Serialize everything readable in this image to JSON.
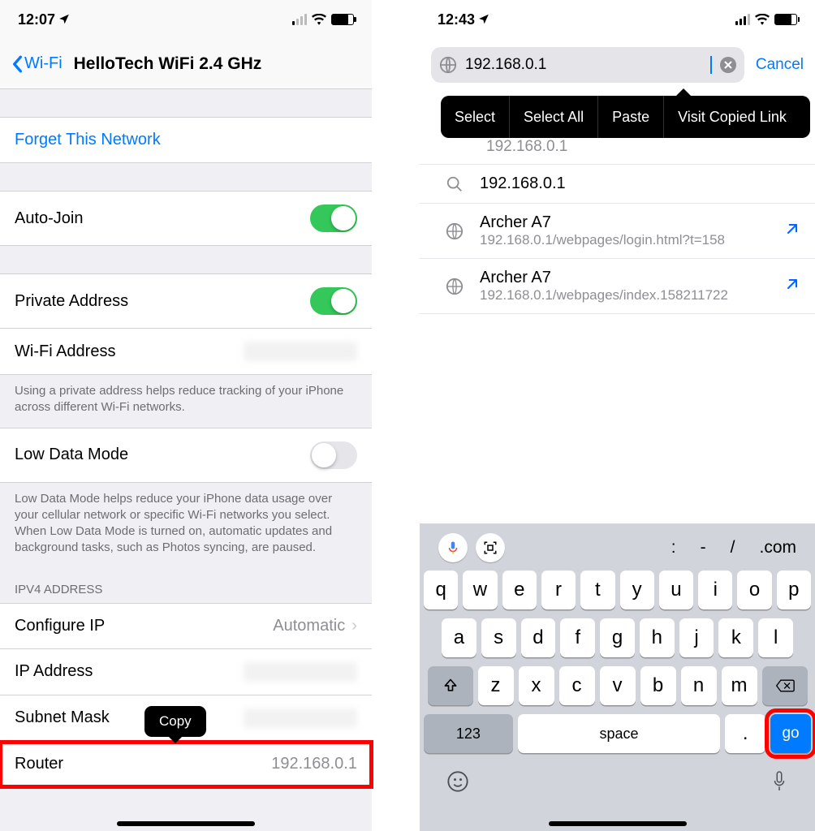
{
  "left": {
    "status_time": "12:07",
    "back_label": "Wi-Fi",
    "page_title": "HelloTech WiFi 2.4 GHz",
    "forget": "Forget This Network",
    "auto_join": "Auto-Join",
    "private_addr": "Private Address",
    "wifi_addr": "Wi-Fi Address",
    "private_footer": "Using a private address helps reduce tracking of your iPhone across different Wi-Fi networks.",
    "low_data": "Low Data Mode",
    "low_data_footer": "Low Data Mode helps reduce your iPhone data usage over your cellular network or specific Wi-Fi networks you select. When Low Data Mode is turned on, automatic updates and background tasks, such as Photos syncing, are paused.",
    "ipv4_header": "IPV4 ADDRESS",
    "configure_ip": "Configure IP",
    "configure_ip_val": "Automatic",
    "ip_address": "IP Address",
    "subnet": "Subnet Mask",
    "router": "Router",
    "router_val": "192.168.0.1",
    "copy": "Copy"
  },
  "right": {
    "status_time": "12:43",
    "url_value": "192.168.0.1",
    "cancel": "Cancel",
    "ctx": {
      "select": "Select",
      "select_all": "Select All",
      "paste": "Paste",
      "visit": "Visit Copied Link"
    },
    "faded_sug": "192.168.0.1",
    "sug_search": "192.168.0.1",
    "sug1_title": "Archer A7",
    "sug1_sub": "192.168.0.1/webpages/login.html?t=158",
    "sug2_title": "Archer A7",
    "sug2_sub": "192.168.0.1/webpages/index.158211722",
    "kbar_shortcuts": {
      "colon": ":",
      "dash": "-",
      "slash": "/",
      "dotcom": ".com"
    },
    "rows": {
      "r1": [
        "q",
        "w",
        "e",
        "r",
        "t",
        "y",
        "u",
        "i",
        "o",
        "p"
      ],
      "r2": [
        "a",
        "s",
        "d",
        "f",
        "g",
        "h",
        "j",
        "k",
        "l"
      ],
      "r3": [
        "z",
        "x",
        "c",
        "v",
        "b",
        "n",
        "m"
      ]
    },
    "k123": "123",
    "space": "space",
    "dot": ".",
    "go": "go"
  }
}
